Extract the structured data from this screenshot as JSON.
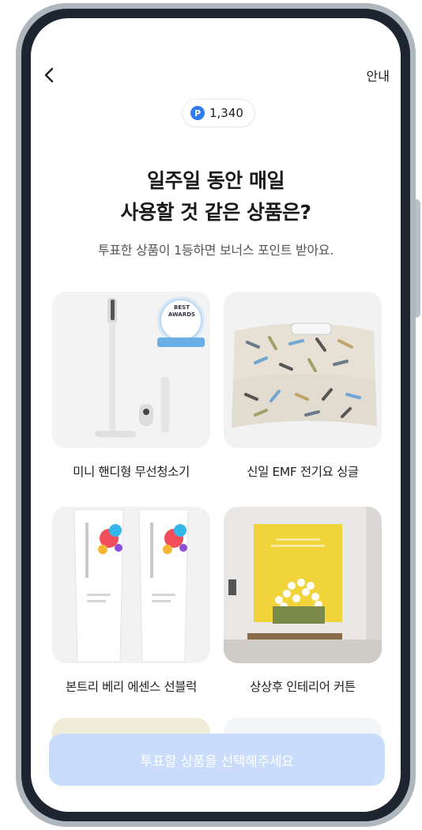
{
  "header": {
    "back_icon": "chevron-left-icon",
    "help_label": "안내",
    "points_icon": "P",
    "points_value": "1,340"
  },
  "headline": {
    "line1": "일주일 동안 매일",
    "line2": "사용할 것 같은 상품은?"
  },
  "subtitle": "투표한 상품이 1등하면 보너스 포인트 받아요.",
  "products": [
    {
      "label": "미니 핸디형 무선청소기",
      "badge_lines": [
        "BEST",
        "AWARDS"
      ],
      "icon": "vacuum-image"
    },
    {
      "label": "신일 EMF 전기요 싱글",
      "icon": "electric-blanket-image"
    },
    {
      "label": "본트리 베리 에센스 선블럭",
      "icon": "sunblock-image"
    },
    {
      "label": "상상후 인테리어 커튼",
      "icon": "curtain-image"
    }
  ],
  "cta": {
    "label": "투표할 상품을 선택해주세요"
  },
  "colors": {
    "accent": "#2f7cf0",
    "cta_disabled": "#c9dcfb",
    "frame": "#1d2530"
  }
}
